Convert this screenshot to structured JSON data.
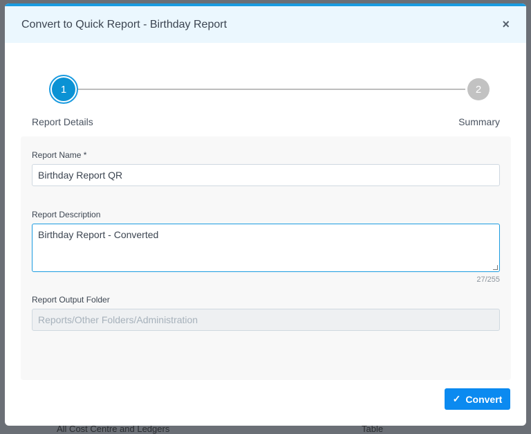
{
  "background": {
    "row_text": "All Cost Centre and Ledgers",
    "row_type": "Table"
  },
  "dialog": {
    "title": "Convert to Quick Report - Birthday Report",
    "close_icon": "×",
    "steps": [
      {
        "number": "1",
        "label": "Report Details",
        "state": "active"
      },
      {
        "number": "2",
        "label": "Summary",
        "state": "inactive"
      }
    ],
    "form": {
      "report_name_label": "Report Name *",
      "report_name_value": "Birthday Report QR",
      "description_label": "Report Description",
      "description_value": "Birthday Report - Converted",
      "description_counter": "27/255",
      "output_folder_label": "Report Output Folder",
      "output_folder_placeholder": "Reports/Other Folders/Administration"
    },
    "convert_label": "Convert",
    "check_icon": "✓",
    "accent_color": "#0b8af0"
  }
}
